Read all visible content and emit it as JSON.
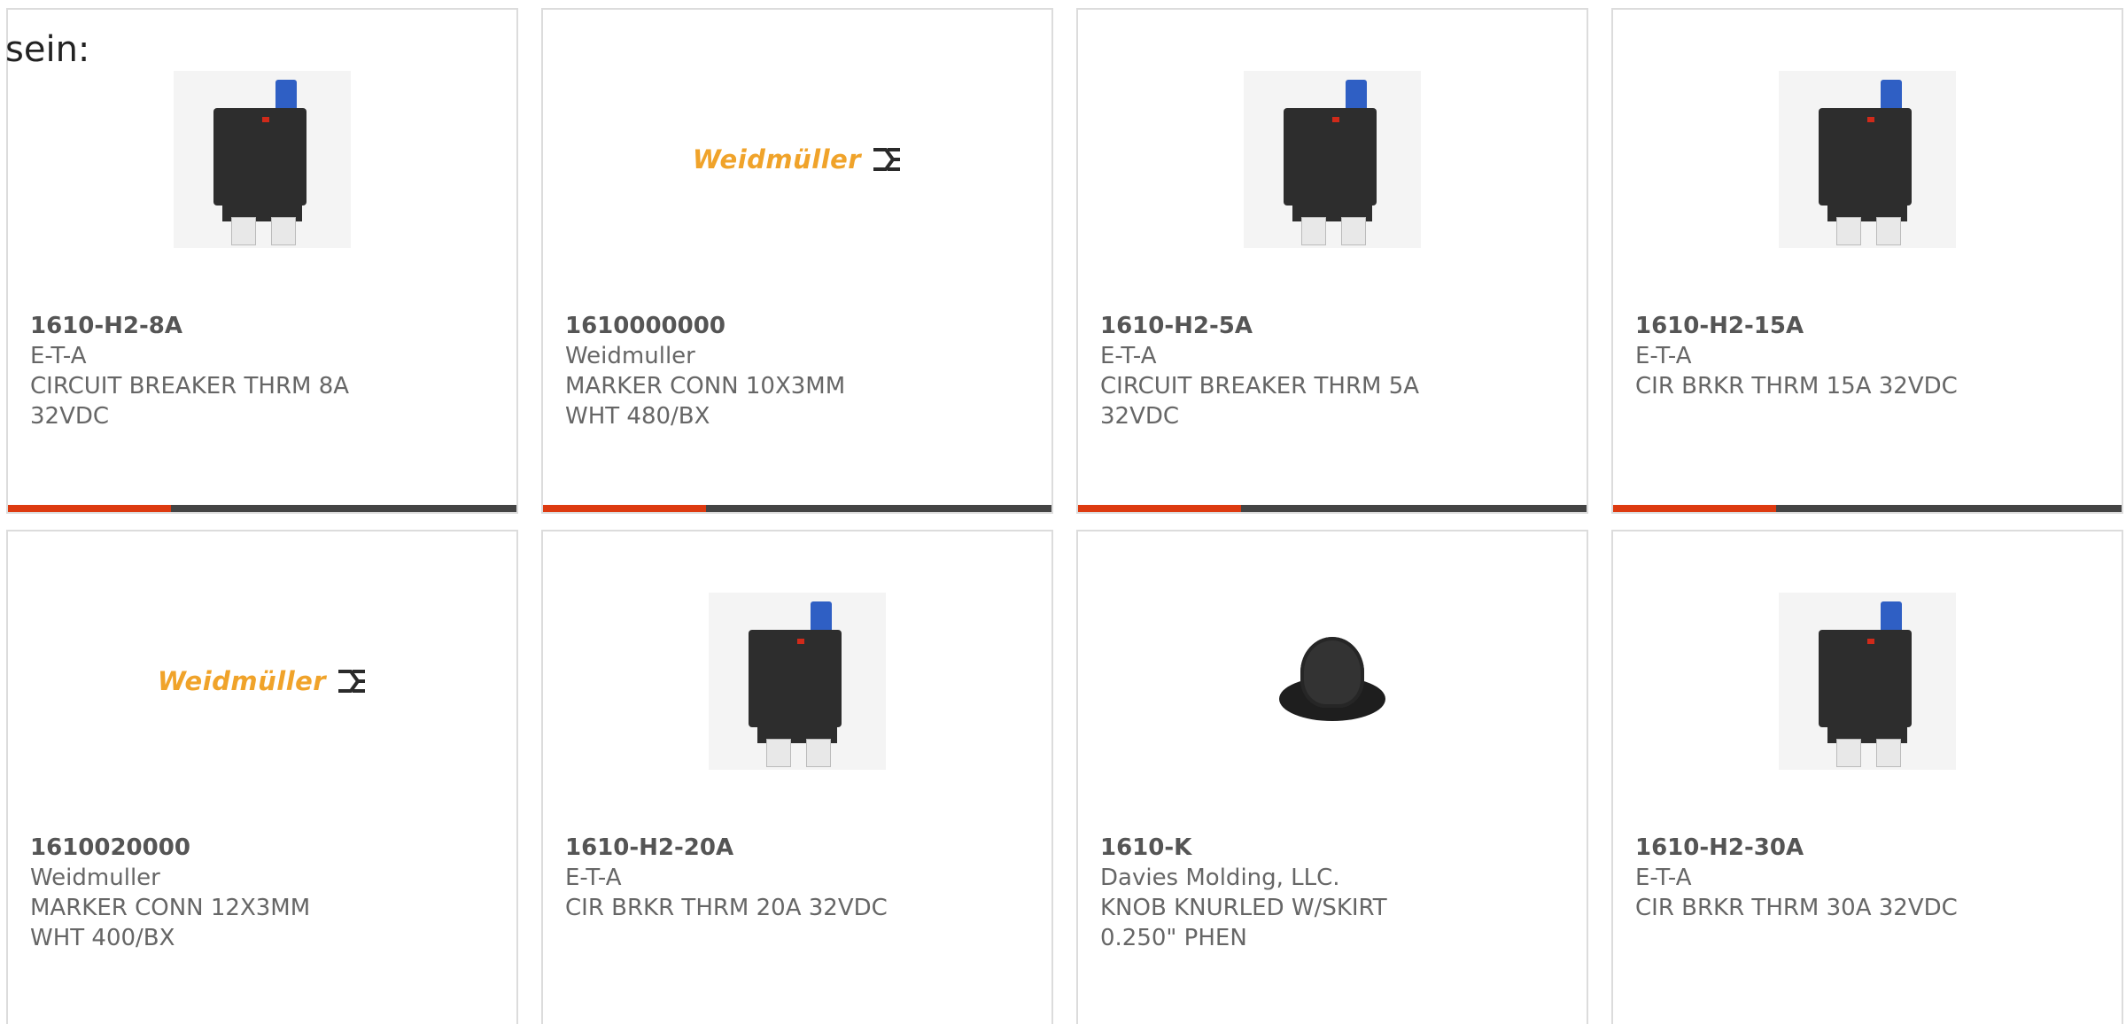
{
  "lead_text": "sein:",
  "colors": {
    "progress_fill": "#dd3a10",
    "progress_track": "#444444",
    "card_border": "#dcdcdc",
    "logo_orange": "#f0a32a"
  },
  "products": [
    {
      "part_number": "1610-H2-8A",
      "manufacturer": "E-T-A",
      "description": "CIRCUIT BREAKER THRM 8A 32VDC",
      "image": "circuit-breaker-icon"
    },
    {
      "part_number": "1610000000",
      "manufacturer": "Weidmuller",
      "description": "MARKER CONN 10X3MM WHT 480/BX",
      "image": "weidmuller-logo",
      "logo_text": "Weidmüller"
    },
    {
      "part_number": "1610-H2-5A",
      "manufacturer": "E-T-A",
      "description": "CIRCUIT BREAKER THRM 5A 32VDC",
      "image": "circuit-breaker-icon"
    },
    {
      "part_number": "1610-H2-15A",
      "manufacturer": "E-T-A",
      "description": "CIR BRKR THRM 15A 32VDC",
      "image": "circuit-breaker-icon"
    },
    {
      "part_number": "1610020000",
      "manufacturer": "Weidmuller",
      "description": "MARKER CONN 12X3MM WHT 400/BX",
      "image": "weidmuller-logo",
      "logo_text": "Weidmüller"
    },
    {
      "part_number": "1610-H2-20A",
      "manufacturer": "E-T-A",
      "description": "CIR BRKR THRM 20A 32VDC",
      "image": "circuit-breaker-icon"
    },
    {
      "part_number": "1610-K",
      "manufacturer": "Davies Molding, LLC.",
      "description": "KNOB KNURLED W/SKIRT 0.250\" PHEN",
      "image": "knob-icon"
    },
    {
      "part_number": "1610-H2-30A",
      "manufacturer": "E-T-A",
      "description": "CIR BRKR THRM 30A 32VDC",
      "image": "circuit-breaker-icon"
    }
  ],
  "progress": {
    "fraction": 0.32
  }
}
